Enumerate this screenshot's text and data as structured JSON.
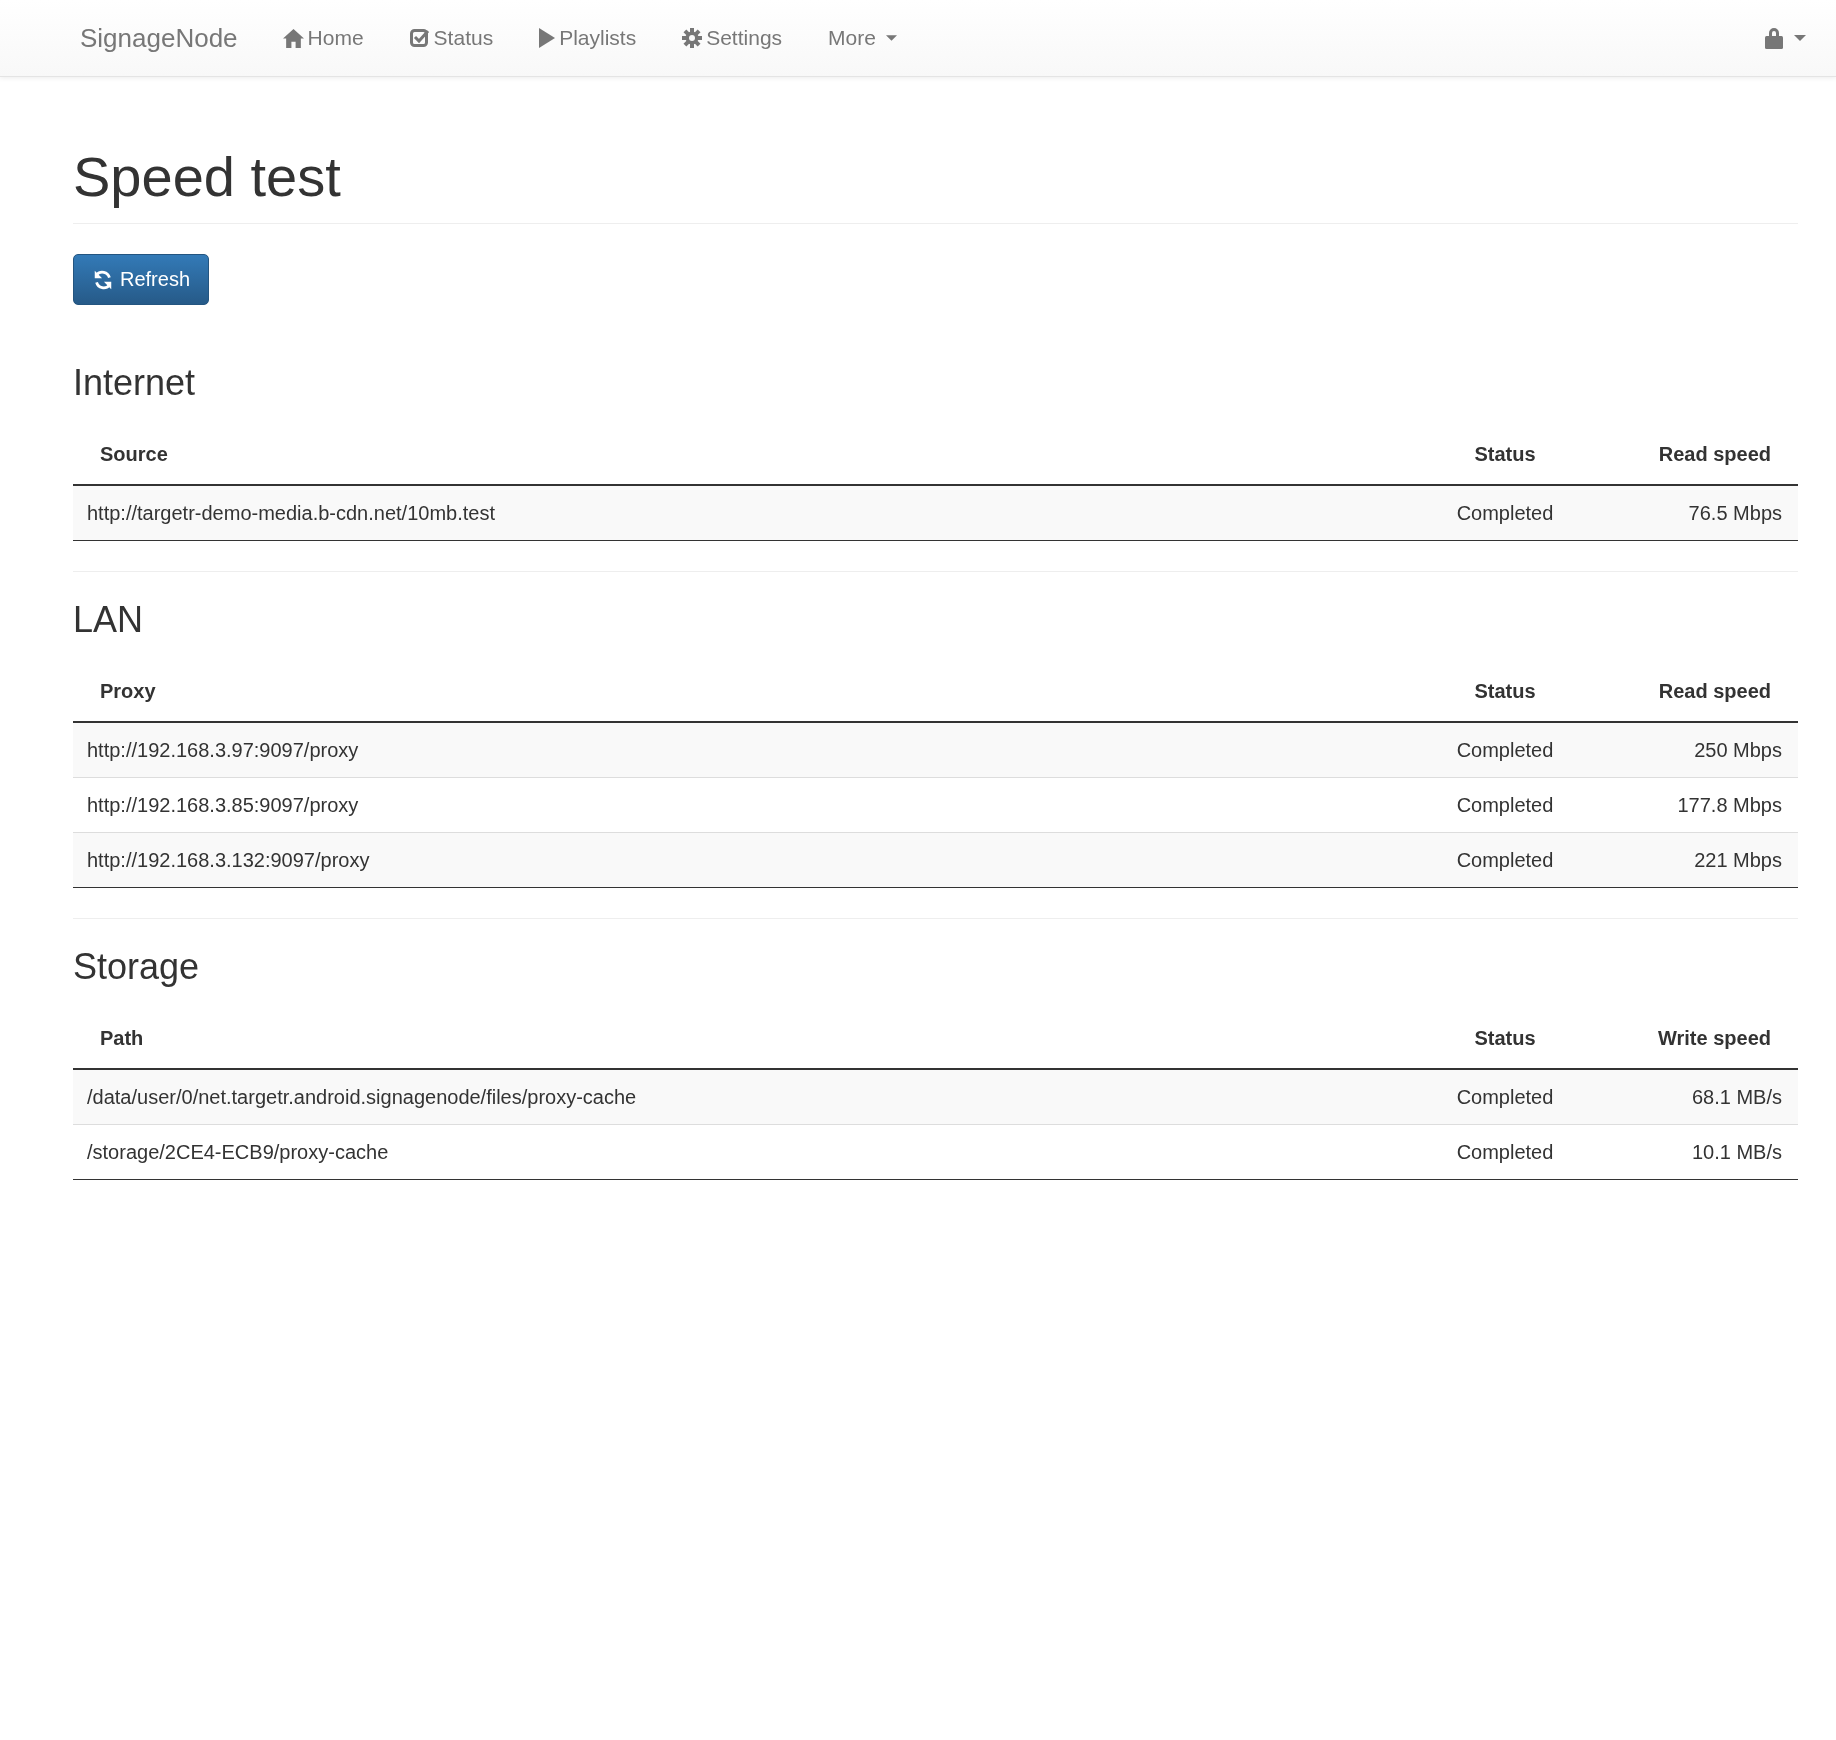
{
  "navbar": {
    "brand": "SignageNode",
    "items": [
      {
        "label": "Home",
        "dropdown": false
      },
      {
        "label": "Status",
        "dropdown": false
      },
      {
        "label": "Playlists",
        "dropdown": false
      },
      {
        "label": "Settings",
        "dropdown": false
      },
      {
        "label": "More",
        "dropdown": true
      }
    ]
  },
  "page": {
    "title": "Speed test",
    "refresh_button": "Refresh"
  },
  "sections": [
    {
      "heading": "Internet",
      "columns": [
        "Source",
        "Status",
        "Read speed"
      ],
      "rows": [
        [
          "http://targetr-demo-media.b-cdn.net/10mb.test",
          "Completed",
          "76.5 Mbps"
        ]
      ]
    },
    {
      "heading": "LAN",
      "columns": [
        "Proxy",
        "Status",
        "Read speed"
      ],
      "rows": [
        [
          "http://192.168.3.97:9097/proxy",
          "Completed",
          "250 Mbps"
        ],
        [
          "http://192.168.3.85:9097/proxy",
          "Completed",
          "177.8 Mbps"
        ],
        [
          "http://192.168.3.132:9097/proxy",
          "Completed",
          "221 Mbps"
        ]
      ]
    },
    {
      "heading": "Storage",
      "columns": [
        "Path",
        "Status",
        "Write speed"
      ],
      "rows": [
        [
          "/data/user/0/net.targetr.android.signagenode/files/proxy-cache",
          "Completed",
          "68.1 MB/s"
        ],
        [
          "/storage/2CE4-ECB9/proxy-cache",
          "Completed",
          "10.1 MB/s"
        ]
      ]
    }
  ]
}
